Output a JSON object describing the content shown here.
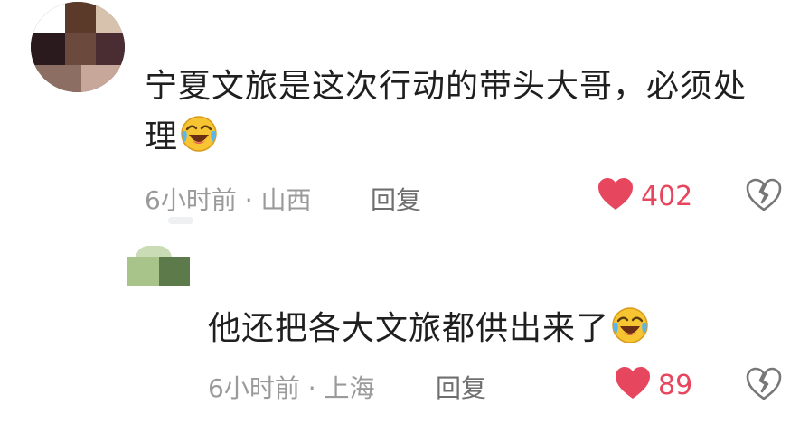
{
  "comment": {
    "text": "宁夏文旅是这次行动的带头大哥，必须处理",
    "time_location": "6小时前 · 山西",
    "reply_label": "回复",
    "like_count": "402",
    "emoji": "laughing-crying-emoji"
  },
  "reply": {
    "text": "他还把各大文旅都供出来了",
    "time_location": "6小时前 · 上海",
    "reply_label": "回复",
    "like_count": "89",
    "emoji": "laughing-crying-emoji"
  },
  "colors": {
    "like_red": "#e6475e",
    "meta_gray": "#9a9a9a",
    "text_dark": "#1f1f1f"
  }
}
